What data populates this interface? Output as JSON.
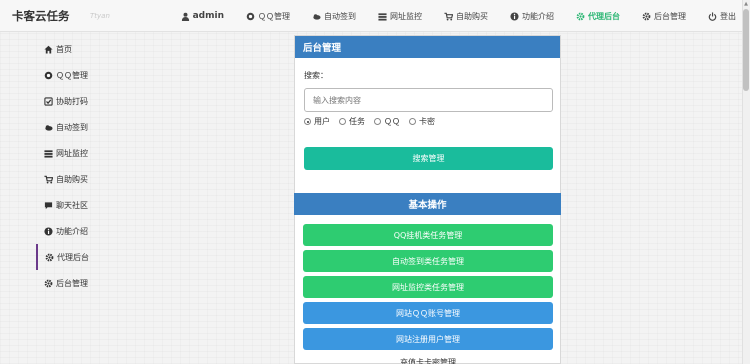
{
  "brand": {
    "title": "卡客云任务",
    "tag": "Ttyan"
  },
  "navbar": {
    "items": [
      {
        "label": "admin",
        "icon": "user-icon"
      },
      {
        "label": "ＱＱ管理",
        "icon": "qq-icon"
      },
      {
        "label": "自动签到",
        "icon": "cloud-icon"
      },
      {
        "label": "网址监控",
        "icon": "list-icon"
      },
      {
        "label": "自助购买",
        "icon": "cart-icon"
      },
      {
        "label": "功能介绍",
        "icon": "info-icon"
      },
      {
        "label": "代理后台",
        "icon": "gear-icon"
      },
      {
        "label": "后台管理",
        "icon": "gear-icon"
      },
      {
        "label": "登出",
        "icon": "power-icon"
      }
    ],
    "active_color": "#2bb673"
  },
  "sidebar": {
    "items": [
      {
        "label": "首页",
        "icon": "home-icon"
      },
      {
        "label": "ＱＱ管理",
        "icon": "qq-icon"
      },
      {
        "label": "协助打码",
        "icon": "check-square-icon"
      },
      {
        "label": "自动签到",
        "icon": "cloud-icon"
      },
      {
        "label": "网址监控",
        "icon": "list-icon"
      },
      {
        "label": "自助购买",
        "icon": "cart-icon"
      },
      {
        "label": "聊天社区",
        "icon": "chat-icon"
      },
      {
        "label": "功能介绍",
        "icon": "info-icon"
      },
      {
        "label": "代理后台",
        "icon": "gear-icon"
      },
      {
        "label": "后台管理",
        "icon": "gear-icon"
      }
    ],
    "active_border": "#6b3a8a"
  },
  "admin_panel": {
    "title": "后台管理",
    "search_label": "搜索：",
    "search_placeholder": "输入搜索内容",
    "radios": [
      "用户",
      "任务",
      "ＱＱ",
      "卡密"
    ],
    "selected_radio": "用户",
    "search_button": "搜索管理",
    "header_color": "#3a7fc1",
    "search_button_color": "#1abc9c"
  },
  "operations": {
    "title": "基本操作",
    "buttons": [
      {
        "label": "QQ挂机类任务管理",
        "color": "#2ecc71"
      },
      {
        "label": "自动签到类任务管理",
        "color": "#2ecc71"
      },
      {
        "label": "网址监控类任务管理",
        "color": "#2ecc71"
      },
      {
        "label": "网站ＱＱ账号管理",
        "color": "#3b97e0"
      },
      {
        "label": "网站注册用户管理",
        "color": "#3b97e0"
      }
    ],
    "footer_text": "充值卡卡密管理"
  }
}
